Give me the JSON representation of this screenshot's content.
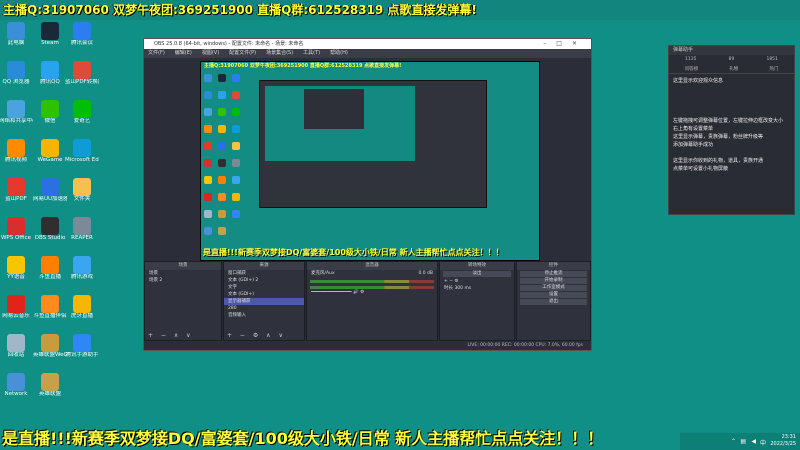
{
  "top_banner": "主播Q:31907060 双梦午夜团:369251900 直播Q群:612528319 点歌直接发弹幕!",
  "desktop_icons": [
    {
      "label": "此电脑",
      "color": "#3b8ed8"
    },
    {
      "label": "Steam",
      "color": "#1b2838"
    },
    {
      "label": "腾讯会议",
      "color": "#2a7ef0"
    },
    {
      "label": "QQ 浏览器",
      "color": "#2a8bd8"
    },
    {
      "label": "腾讯QQ",
      "color": "#29a3f0"
    },
    {
      "label": "蓝山PDF转换器",
      "color": "#e04a3a"
    },
    {
      "label": "网络和共享中心",
      "color": "#4aa3df"
    },
    {
      "label": "微信",
      "color": "#2dc100"
    },
    {
      "label": "爱奇艺",
      "color": "#00be06"
    },
    {
      "label": "腾讯视频",
      "color": "#ff8a00"
    },
    {
      "label": "WeGame",
      "color": "#f5b400"
    },
    {
      "label": "Microsoft Edge",
      "color": "#0f9bd7"
    },
    {
      "label": "蓝山PDF",
      "color": "#e23b2e"
    },
    {
      "label": "网易UU加速器",
      "color": "#2b6fe0"
    },
    {
      "label": "文件夹",
      "color": "#f2c14e"
    },
    {
      "label": "WPS Office",
      "color": "#d6302e"
    },
    {
      "label": "OBS Studio",
      "color": "#302e31"
    },
    {
      "label": "REAPER",
      "color": "#7a8a99"
    },
    {
      "label": "YY语音",
      "color": "#f7c600"
    },
    {
      "label": "斗鱼直播",
      "color": "#ff7f00"
    },
    {
      "label": "腾讯游戏",
      "color": "#3aa6f0"
    },
    {
      "label": "网易云音乐",
      "color": "#e2231a"
    },
    {
      "label": "斗鱼直播伴侣",
      "color": "#ff8c1a"
    },
    {
      "label": "虎牙直播",
      "color": "#f6b500"
    },
    {
      "label": "回收站",
      "color": "#9fb7c7"
    },
    {
      "label": "英雄联盟WeGame版",
      "color": "#c89b3c"
    },
    {
      "label": "腾讯手游助手",
      "color": "#2f86f5"
    },
    {
      "label": "Network",
      "color": "#4a90d9"
    },
    {
      "label": "英雄联盟",
      "color": "#c8a04b"
    }
  ],
  "obs": {
    "title": "OBS 25.0.8 (64-bit, windows) - 配置文件: 未命名 - 场景: 未命名",
    "menu": [
      "文件(F)",
      "编辑(E)",
      "视图(V)",
      "配置文件(P)",
      "场景集合(S)",
      "工具(T)",
      "帮助(H)"
    ],
    "preview_banner": "主播Q:31907060 双梦午夜团:369251900 直播Q群:612528319 点歌直接发弹幕!",
    "preview_ticker": "是直播!!!新赛季双梦接DQ/富婆套/100级大小铁/日常 新人主播帮忙点点关注！！！",
    "docks": {
      "scenes": {
        "header": "场景",
        "items": [
          "场景",
          "场景 2"
        ]
      },
      "sources": {
        "header": "来源",
        "items": [
          "窗口捕获",
          "文本 (GDI+) 2",
          "文字",
          "文本 (GDI+)",
          "显示器捕获",
          "280",
          "音频输入"
        ]
      },
      "mixer": {
        "header": "混音器",
        "item": "麦克风/Aux",
        "level": "0.0 dB"
      },
      "transitions": {
        "header": "转场特效",
        "mode": "淡出",
        "duration_label": "时长",
        "duration": "300 ms"
      },
      "controls": {
        "header": "控件",
        "buttons": [
          "停止推流",
          "开始录制",
          "工作室模式",
          "设置",
          "退出"
        ]
      }
    },
    "status": "LIVE: 00:00:00   REC: 00:00:00   CPU: 7.0%, 60.00 fps"
  },
  "chat": {
    "header": "弹幕助手",
    "stats": [
      "1135",
      "89",
      "1851"
    ],
    "tabs": [
      "问答榜",
      "礼物",
      "热门"
    ],
    "messages": [
      "这里显示欢迎观众信息",
      "左键拖拽可调整弹幕位置，左键拉伸边框改变大小",
      "右上角有设置菜单",
      "这里显示弹幕，贵族弹幕，粉丝牌升级等",
      "添加弹幕助手成功",
      "这里显示你收到的礼物，道具，贵族开通",
      "点菜单可设置小礼物屏蔽"
    ]
  },
  "bottom_ticker": "是直播!!!新赛季双梦接DQ/富婆套/100级大小铁/日常 新人主播帮忙点点关注！！！",
  "tray": {
    "time": "23:31",
    "date": "2022/3/25"
  }
}
